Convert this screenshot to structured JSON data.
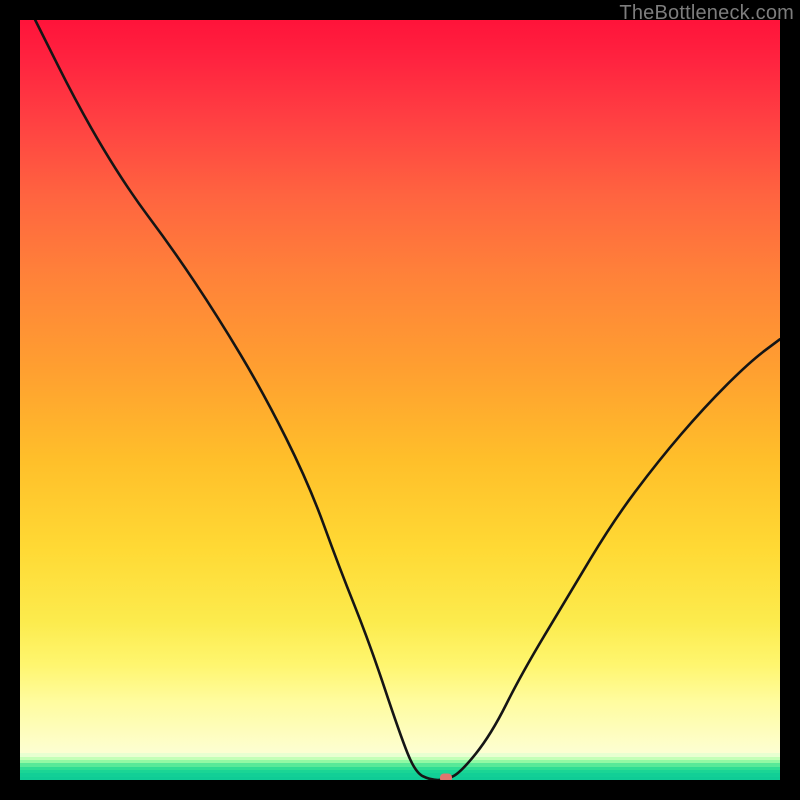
{
  "watermark": "TheBottleneck.com",
  "colors": {
    "frame": "#000000",
    "gradient_stops": [
      "#ff133a",
      "#ff2540",
      "#ff4142",
      "#ff6440",
      "#ff8239",
      "#ffa030",
      "#ffbf2a",
      "#ffd934",
      "#fceb4d",
      "#fff66f",
      "#fffc9f",
      "#fdfed2"
    ],
    "bottom_bands": [
      "#e8ffd1",
      "#c4ffb8",
      "#92f9a4",
      "#58e998",
      "#2fdd94",
      "#1ad595",
      "#12cf96",
      "#0fcc96"
    ],
    "curve": "#151515",
    "marker": "#e0766f"
  },
  "chart_data": {
    "type": "line",
    "title": "",
    "xlabel": "",
    "ylabel": "",
    "ylim": [
      0,
      100
    ],
    "xlim": [
      0,
      100
    ],
    "x": [
      2,
      8,
      14,
      20,
      26,
      32,
      38,
      42,
      46,
      50,
      52,
      54,
      56,
      58,
      62,
      66,
      72,
      78,
      84,
      90,
      96,
      100
    ],
    "values": [
      100,
      88,
      78,
      70,
      61,
      51,
      39,
      28,
      18,
      6,
      1,
      0,
      0,
      1,
      6,
      14,
      24,
      34,
      42,
      49,
      55,
      58
    ],
    "marker": {
      "x": 56,
      "y": 0
    },
    "note": "y is bottleneck percentage (0 = none, at bottom green band; 100 = max, at top red). x is normalized horizontal position."
  }
}
